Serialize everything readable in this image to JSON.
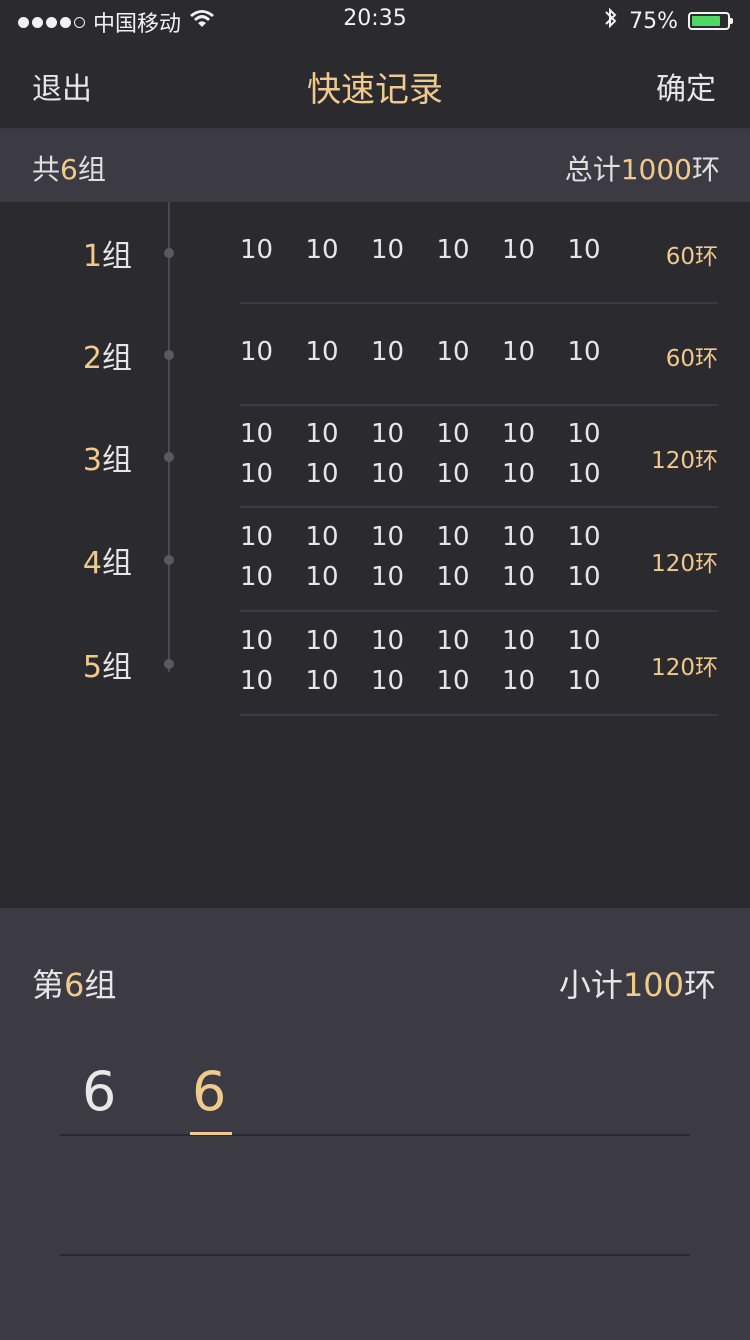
{
  "status_bar": {
    "carrier": "中国移动",
    "time": "20:35",
    "battery_percent": "75%",
    "battery_level": 0.75,
    "signal_bars_filled": 4,
    "signal_bars_total": 5
  },
  "nav": {
    "exit_label": "退出",
    "title": "快速记录",
    "confirm_label": "确定"
  },
  "summary": {
    "groups_prefix": "共",
    "groups_count": "6",
    "groups_suffix": "组",
    "total_prefix": "总计",
    "total_value": "1000",
    "total_suffix": "环"
  },
  "groups": [
    {
      "num": "1",
      "suffix": "组",
      "rows": [
        [
          "10",
          "10",
          "10",
          "10",
          "10",
          "10"
        ]
      ],
      "total": "60环"
    },
    {
      "num": "2",
      "suffix": "组",
      "rows": [
        [
          "10",
          "10",
          "10",
          "10",
          "10",
          "10"
        ]
      ],
      "total": "60环"
    },
    {
      "num": "3",
      "suffix": "组",
      "rows": [
        [
          "10",
          "10",
          "10",
          "10",
          "10",
          "10"
        ],
        [
          "10",
          "10",
          "10",
          "10",
          "10",
          "10"
        ]
      ],
      "total": "120环"
    },
    {
      "num": "4",
      "suffix": "组",
      "rows": [
        [
          "10",
          "10",
          "10",
          "10",
          "10",
          "10"
        ],
        [
          "10",
          "10",
          "10",
          "10",
          "10",
          "10"
        ]
      ],
      "total": "120环"
    },
    {
      "num": "5",
      "suffix": "组",
      "rows": [
        [
          "10",
          "10",
          "10",
          "10",
          "10",
          "10"
        ],
        [
          "10",
          "10",
          "10",
          "10",
          "10",
          "10"
        ]
      ],
      "total": "120环"
    }
  ],
  "current": {
    "prefix": "第",
    "num": "6",
    "suffix": "组",
    "subtotal_prefix": "小计",
    "subtotal_value": "100",
    "subtotal_suffix": "环",
    "entries": [
      "6",
      "6"
    ]
  },
  "colors": {
    "accent": "#f0c98c",
    "background": "#2b2a2f",
    "panel": "#3c3b43",
    "battery": "#4cd964"
  }
}
